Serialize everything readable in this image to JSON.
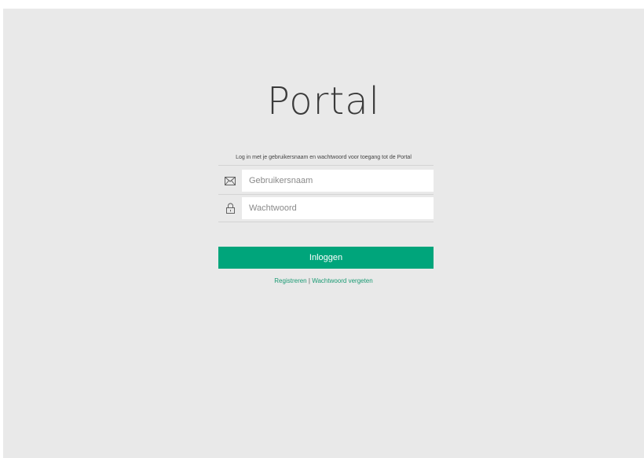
{
  "app": {
    "title": "Portal",
    "instruction": "Log in met je gebruikersnaam en wachtwoord voor toegang tot de Portal"
  },
  "form": {
    "username": {
      "placeholder": "Gebruikersnaam",
      "value": "",
      "icon": "envelope-icon"
    },
    "password": {
      "placeholder": "Wachtwoord",
      "value": "",
      "icon": "lock-icon"
    },
    "submit_label": "Inloggen"
  },
  "links": {
    "register": "Registreren",
    "separator": "|",
    "forgot_password": "Wachtwoord vergeten"
  },
  "colors": {
    "background": "#e9e9e9",
    "accent": "#00a57b",
    "link": "#1a9a73"
  }
}
